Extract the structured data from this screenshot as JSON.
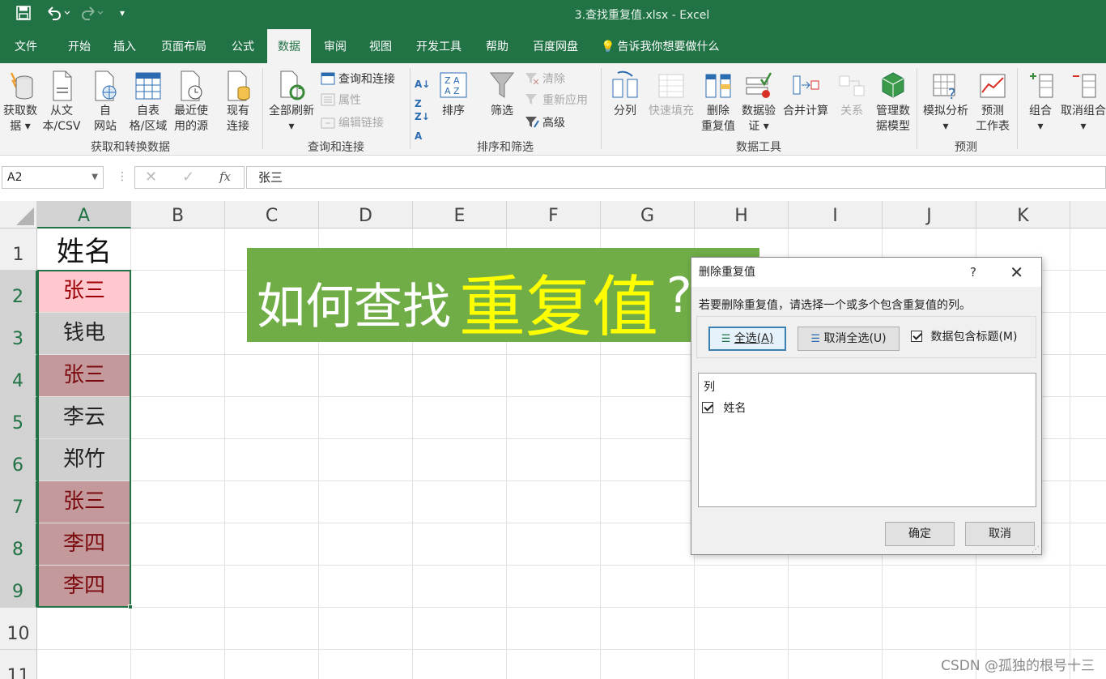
{
  "window": {
    "title": "3.查找重复值.xlsx  -  Excel"
  },
  "tabs": [
    {
      "label": "文件"
    },
    {
      "label": "开始"
    },
    {
      "label": "插入"
    },
    {
      "label": "页面布局"
    },
    {
      "label": "公式"
    },
    {
      "label": "数据",
      "active": true
    },
    {
      "label": "审阅"
    },
    {
      "label": "视图"
    },
    {
      "label": "开发工具"
    },
    {
      "label": "帮助"
    },
    {
      "label": "百度网盘"
    }
  ],
  "tell_me": "告诉我你想要做什么",
  "ribbon": {
    "get_data": [
      "获取数",
      "据"
    ],
    "from_csv": [
      "从文",
      "本/CSV"
    ],
    "from_web": [
      "自",
      "网站"
    ],
    "from_table": [
      "自表",
      "格/区域"
    ],
    "recent_sources": [
      "最近使",
      "用的源"
    ],
    "existing_conn": [
      "现有",
      "连接"
    ],
    "refresh_all": [
      "全部刷新"
    ],
    "queries_conn": "查询和连接",
    "properties": "属性",
    "edit_links": "编辑链接",
    "sort": "排序",
    "filter": "筛选",
    "clear": "清除",
    "reapply": "重新应用",
    "advanced": "高级",
    "text_to_columns": "分列",
    "flash_fill": "快速填充",
    "remove_dup": [
      "删除",
      "重复值"
    ],
    "data_validation": [
      "数据验",
      "证"
    ],
    "consolidate": "合并计算",
    "relationships": "关系",
    "manage_model": [
      "管理数",
      "据模型"
    ],
    "what_if": [
      "模拟分析"
    ],
    "forecast_sheet": [
      "预测",
      "工作表"
    ],
    "group": "组合",
    "ungroup": "取消组合",
    "groups": {
      "get_transform": "获取和转换数据",
      "queries": "查询和连接",
      "sort_filter": "排序和筛选",
      "data_tools": "数据工具",
      "forecast": "预测"
    }
  },
  "formula_bar": {
    "name_box": "A2",
    "formula": "张三",
    "fx": "fx"
  },
  "sheet": {
    "columns": [
      "A",
      "B",
      "C",
      "D",
      "E",
      "F",
      "G",
      "H",
      "I",
      "J",
      "K"
    ],
    "rows": [
      "1",
      "2",
      "3",
      "4",
      "5",
      "6",
      "7",
      "8",
      "9",
      "10",
      "11"
    ],
    "cells": [
      {
        "text": "姓名",
        "bg": "#ffffff",
        "color": "#111111"
      },
      {
        "text": "张三",
        "bg": "#ffc7ce",
        "color": "#9c0006"
      },
      {
        "text": "钱电",
        "bg": "#d0d0d0",
        "color": "#222222"
      },
      {
        "text": "张三",
        "bg": "#c4999b",
        "color": "#7a0a0e"
      },
      {
        "text": "李云",
        "bg": "#d0d0d0",
        "color": "#222222"
      },
      {
        "text": "郑竹",
        "bg": "#d0d0d0",
        "color": "#222222"
      },
      {
        "text": "张三",
        "bg": "#c4999b",
        "color": "#7a0a0e"
      },
      {
        "text": "李四",
        "bg": "#c4999b",
        "color": "#7a0a0e"
      },
      {
        "text": "李四",
        "bg": "#c4999b",
        "color": "#7a0a0e"
      }
    ],
    "banner": {
      "prefix": "如何查找",
      "highlight": "重复值",
      "suffix": "?"
    }
  },
  "dialog": {
    "title": "删除重复值",
    "help": "?",
    "description": "若要删除重复值，请选择一个或多个包含重复值的列。",
    "select_all": "全选(A)",
    "unselect_all": "取消全选(U)",
    "has_headers": "数据包含标题(M)",
    "list_header": "列",
    "columns": [
      {
        "label": "姓名",
        "checked": true
      }
    ],
    "ok": "确定",
    "cancel": "取消"
  },
  "watermark": "CSDN @孤独的根号十三",
  "colors": {
    "excel_green": "#217346",
    "banner_green": "#70ad47",
    "banner_yellow": "#ffff00"
  }
}
